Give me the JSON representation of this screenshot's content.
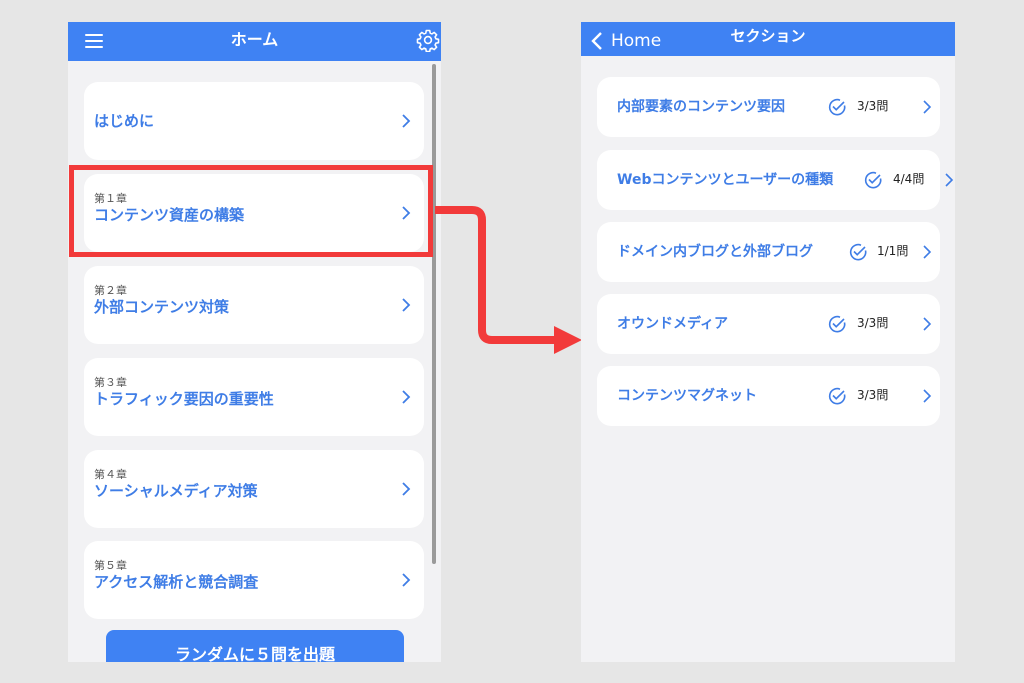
{
  "home": {
    "title": "ホーム",
    "cards": [
      {
        "chapter": "",
        "title": "はじめに"
      },
      {
        "chapter": "第１章",
        "title": "コンテンツ資産の構築"
      },
      {
        "chapter": "第２章",
        "title": "外部コンテンツ対策"
      },
      {
        "chapter": "第３章",
        "title": "トラフィック要因の重要性"
      },
      {
        "chapter": "第４章",
        "title": "ソーシャルメディア対策"
      },
      {
        "chapter": "第５章",
        "title": "アクセス解析と競合調査"
      }
    ],
    "random_button": "ランダムに５問を出題"
  },
  "section": {
    "back_label": "Home",
    "title": "セクション",
    "items": [
      {
        "title": "内部要素のコンテンツ要因",
        "count": "3/3問"
      },
      {
        "title": "Webコンテンツとユーザーの種類",
        "count": "4/4問"
      },
      {
        "title": "ドメイン内ブログと外部ブログ",
        "count": "1/1問"
      },
      {
        "title": "オウンドメディア",
        "count": "3/3問"
      },
      {
        "title": "コンテンツマグネット",
        "count": "3/3問"
      }
    ]
  },
  "colors": {
    "accent": "#3f82f3",
    "highlight": "#f23a3a",
    "background": "#f2f2f4"
  },
  "icons": [
    "hamburger-menu-icon",
    "gear-icon",
    "chevron-right-icon",
    "back-chevron-icon",
    "check-circle-icon",
    "arrow-icon"
  ]
}
